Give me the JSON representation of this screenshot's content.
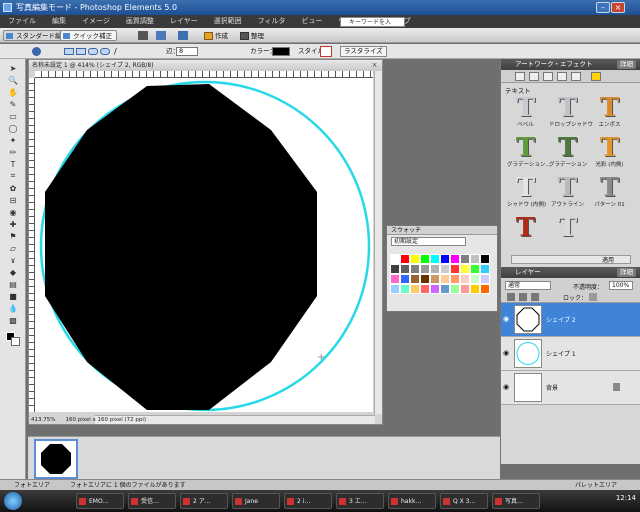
{
  "window": {
    "title": "写真編集モード - Photoshop Elements 5.0",
    "min": "–",
    "max": "□",
    "close": "×"
  },
  "menu": {
    "items": [
      "ファイル",
      "編集",
      "イメージ",
      "画質調整",
      "レイヤー",
      "選択範囲",
      "フィルタ",
      "ビュー",
      "ウィンドウ",
      "ヘルプ"
    ],
    "search_placeholder": "キーワードを入力"
  },
  "modes": {
    "standard": "スタンダード編集",
    "quick": "クイック補正",
    "create": "作成",
    "organize": "整理"
  },
  "options": {
    "radius_label": "辺：",
    "radius_value": "8",
    "color_label": "カラー：",
    "style_label": "スタイル：",
    "rasterize": "ラスタライズ"
  },
  "document": {
    "title": "名称未設定 1 @ 414% (シェイプ 2, RGB/8)",
    "zoom": "413.75%",
    "size": "160 pixel x 160 pixel (72 ppi)"
  },
  "swatches": {
    "title": "スウォッチ",
    "set": "初期設定",
    "colors": [
      "#ffffff",
      "#ff0000",
      "#ffff00",
      "#00ff00",
      "#00ffff",
      "#0000ff",
      "#ff00ff",
      "#808080",
      "#c0c0c0",
      "#000000",
      "#404040",
      "#606060",
      "#7f7f7f",
      "#999999",
      "#b3b3b3",
      "#cccccc",
      "#ff3333",
      "#ffff33",
      "#33ff33",
      "#33ccff",
      "#ff66cc",
      "#3366ff",
      "#996633",
      "#663300",
      "#cc9966",
      "#ffcc99",
      "#ff9966",
      "#ffcccc",
      "#ccffcc",
      "#ccccff",
      "#99ccff",
      "#66ffcc",
      "#ffcc66",
      "#ff6666",
      "#cc66ff",
      "#6699cc",
      "#99ff99",
      "#ff9999",
      "#ffcc00",
      "#ff6600"
    ]
  },
  "effects": {
    "title": "アートワーク・エフェクト",
    "more": "詳細",
    "category": "テキスト",
    "items": [
      {
        "name": "ベベル",
        "color": "#c7cbd0"
      },
      {
        "name": "ドロップシャドウ",
        "color": "#bfc3c8"
      },
      {
        "name": "エンボス",
        "color": "#d88b2a"
      },
      {
        "name": "グラデーション...",
        "color": "#5f9b3a"
      },
      {
        "name": "グラデーション",
        "color": "#4d7a3a"
      },
      {
        "name": "光彩 (内側)",
        "color": "#e2962a"
      },
      {
        "name": "シャドウ (内側)",
        "color": "#e4e4e4"
      },
      {
        "name": "アウトライン",
        "color": "#b9b9b9"
      },
      {
        "name": "パターン 01",
        "color": "#8a8a8a"
      },
      {
        "name": "",
        "color": "#b02a18"
      },
      {
        "name": "",
        "color": "#d9d9d9"
      }
    ],
    "apply": "適用"
  },
  "layers": {
    "title": "レイヤー",
    "more": "詳細",
    "blend": "通常",
    "opacity_label": "不透明度：",
    "opacity": "100%",
    "lock": "ロック：",
    "items": [
      {
        "name": "シェイプ 2",
        "selected": true
      },
      {
        "name": "シェイプ 1",
        "selected": false
      },
      {
        "name": "背景",
        "selected": false
      }
    ]
  },
  "bin": {
    "left": "フォトエリア",
    "status": "フォトエリアに 1 個のファイルがあります",
    "right": "パレットエリア"
  },
  "taskbar": {
    "items": [
      "EMO…",
      "受信…",
      "2 ア…",
      "Jane",
      "2 i…",
      "3 エ…",
      "hakk…",
      "Q X 3…",
      "写真…"
    ],
    "clock": "12:14"
  }
}
